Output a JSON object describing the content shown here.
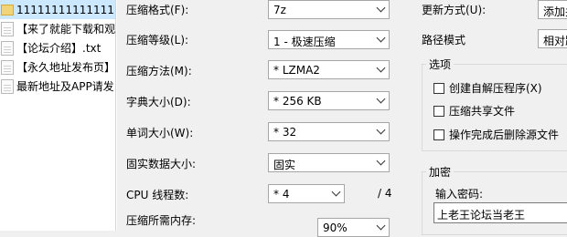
{
  "file_list": [
    {
      "name": "111111111111111",
      "type": "folder",
      "selected": true
    },
    {
      "name": "【来了就能下载和观",
      "type": "file"
    },
    {
      "name": "【论坛介绍】.txt",
      "type": "file"
    },
    {
      "name": "【永久地址发布页】",
      "type": "file"
    },
    {
      "name": "最新地址及APP请发",
      "type": "file"
    }
  ],
  "left": {
    "format_label": "压缩格式(F):",
    "format_value": "7z",
    "level_label": "压缩等级(L):",
    "level_value": "1 - 极速压缩",
    "method_label": "压缩方法(M):",
    "method_value": "* LZMA2",
    "dict_label": "字典大小(D):",
    "dict_value": "* 256 KB",
    "word_label": "单词大小(W):",
    "word_value": "* 32",
    "solid_label": "固实数据大小:",
    "solid_value": "固实",
    "cpu_label": "CPU 线程数:",
    "cpu_value": "* 4",
    "cpu_total": "/ 4",
    "memory_label": "压缩所需内存:",
    "memory_value": "90%"
  },
  "right": {
    "update_label": "更新方式(U):",
    "update_value": "添加并",
    "path_label": "路径模式",
    "path_value": "相对路",
    "options_title": "选项",
    "opt_sfx": "创建自解压程序(X)",
    "opt_shared": "压缩共享文件",
    "opt_delete": "操作完成后删除源文件",
    "encrypt_title": "加密",
    "password_label": "输入密码:",
    "password_value": "上老王论坛当老王"
  }
}
